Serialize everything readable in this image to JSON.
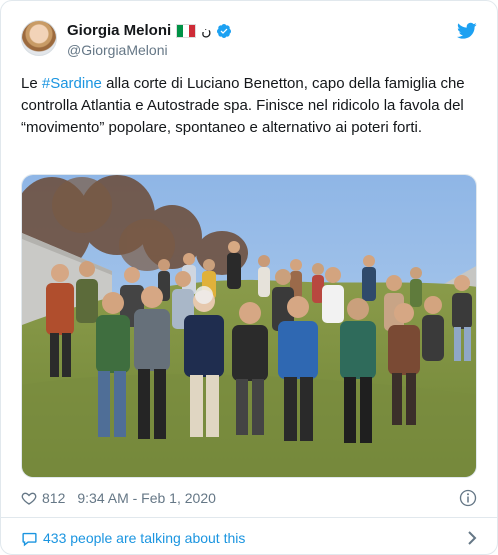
{
  "user": {
    "display_name": "Giorgia Meloni",
    "handle": "@GiorgiaMeloni",
    "name_suffix": "ن",
    "verified": true,
    "icons": [
      "avatar",
      "italy-flag-icon",
      "verified-badge-icon",
      "twitter-bird-icon"
    ]
  },
  "tweet": {
    "text_before": "Le ",
    "hashtag": "#Sardine",
    "text_after": " alla corte di Luciano Benetton, capo della famiglia che controlla Atlantia e Autostrade spa. Finisce nel ridicolo la favola del “movimento” popolare, spontaneo e alternativo ai poteri forti.",
    "image_icon": "group-photo"
  },
  "meta": {
    "likes": "812",
    "timestamp": "9:34 AM - Feb 1, 2020",
    "icons": [
      "heart-icon",
      "info-icon"
    ]
  },
  "footer": {
    "talking_label": "433 people are talking about this",
    "icons": [
      "speech-bubble-icon",
      "chevron-right-icon"
    ]
  },
  "colors": {
    "link": "#1b95e0",
    "text": "#14171a",
    "muted": "#657786",
    "border": "#e1e8ed",
    "verified": "#1da1f2"
  }
}
